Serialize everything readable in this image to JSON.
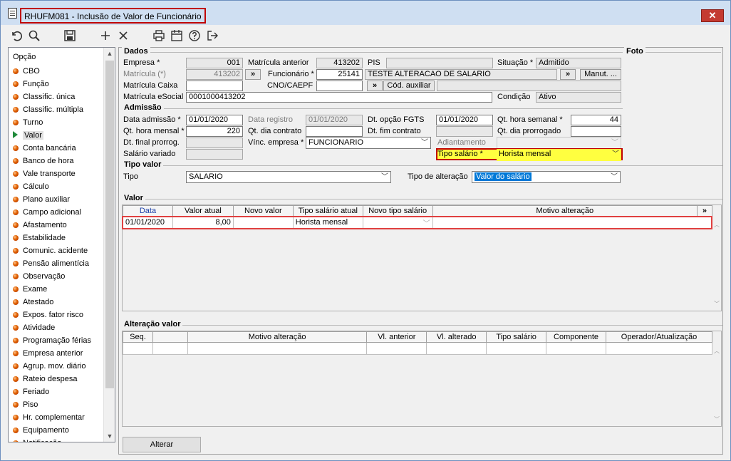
{
  "window": {
    "title": "RHUFM081 - Inclusão de Valor de Funcionário",
    "close_glyph": "✕"
  },
  "toolbar": {
    "icons": [
      "undo-icon",
      "search-icon",
      "save-icon",
      "add-icon",
      "delete-icon",
      "print-icon",
      "calendar-icon",
      "help-icon",
      "exit-icon"
    ]
  },
  "sidebar": {
    "header": "Opção",
    "items": [
      {
        "label": "CBO",
        "selected": false
      },
      {
        "label": "Função",
        "selected": false
      },
      {
        "label": "Classific. única",
        "selected": false
      },
      {
        "label": "Classific. múltipla",
        "selected": false
      },
      {
        "label": "Turno",
        "selected": false
      },
      {
        "label": "Valor",
        "selected": true
      },
      {
        "label": "Conta bancária",
        "selected": false
      },
      {
        "label": "Banco de hora",
        "selected": false
      },
      {
        "label": "Vale transporte",
        "selected": false
      },
      {
        "label": "Cálculo",
        "selected": false
      },
      {
        "label": "Plano auxiliar",
        "selected": false
      },
      {
        "label": "Campo adicional",
        "selected": false
      },
      {
        "label": "Afastamento",
        "selected": false
      },
      {
        "label": "Estabilidade",
        "selected": false
      },
      {
        "label": "Comunic. acidente",
        "selected": false
      },
      {
        "label": "Pensão alimentícia",
        "selected": false
      },
      {
        "label": "Observação",
        "selected": false
      },
      {
        "label": "Exame",
        "selected": false
      },
      {
        "label": "Atestado",
        "selected": false
      },
      {
        "label": "Expos. fator risco",
        "selected": false
      },
      {
        "label": "Atividade",
        "selected": false
      },
      {
        "label": "Programação férias",
        "selected": false
      },
      {
        "label": "Empresa anterior",
        "selected": false
      },
      {
        "label": "Agrup. mov. diário",
        "selected": false
      },
      {
        "label": "Rateio despesa",
        "selected": false
      },
      {
        "label": "Feriado",
        "selected": false
      },
      {
        "label": "Piso",
        "selected": false
      },
      {
        "label": "Hr. complementar",
        "selected": false
      },
      {
        "label": "Equipamento",
        "selected": false
      },
      {
        "label": "Notificação",
        "selected": false
      }
    ]
  },
  "dados": {
    "title": "Dados",
    "foto_title": "Foto",
    "empresa_label": "Empresa *",
    "empresa": "001",
    "matricula_anterior_label": "Matrícula anterior",
    "matricula_anterior": "413202",
    "pis_label": "PIS",
    "pis": "",
    "situacao_label": "Situação *",
    "situacao": "Admitido",
    "matricula_label": "Matrícula (*)",
    "matricula": "413202",
    "expand_btn": "»",
    "funcionario_label": "Funcionário *",
    "funcionario": "25141",
    "funcionario_nome": "TESTE ALTERACAO DE SALARIO",
    "manut_btn": "Manut. ...",
    "matricula_caixa_label": "Matrícula Caixa",
    "matricula_caixa": "",
    "cno_label": "CNO/CAEPF",
    "cno": "",
    "cod_auxiliar_btn": "Cód. auxiliar",
    "cod_auxiliar": "",
    "matricula_esocial_label": "Matrícula eSocial",
    "matricula_esocial": "0001000413202",
    "condicao_label": "Condição",
    "condicao": "Ativo"
  },
  "admissao": {
    "title": "Admissão",
    "data_admissao_label": "Data admissão *",
    "data_admissao": "01/01/2020",
    "data_registro_label": "Data registro",
    "data_registro": "01/01/2020",
    "dt_opcao_fgts_label": "Dt. opção FGTS",
    "dt_opcao_fgts": "01/01/2020",
    "qt_hora_semanal_label": "Qt. hora semanal *",
    "qt_hora_semanal": "44",
    "qt_hora_mensal_label": "Qt. hora mensal *",
    "qt_hora_mensal": "220",
    "qt_dia_contrato_label": "Qt. dia contrato",
    "qt_dia_contrato": "",
    "dt_fim_contrato_label": "Dt. fim contrato",
    "dt_fim_contrato": "",
    "qt_dia_prorrogado_label": "Qt. dia prorrogado",
    "qt_dia_prorrogado": "",
    "dt_final_prorrog_label": "Dt. final prorrog.",
    "dt_final_prorrog": "",
    "vinc_empresa_label": "Vínc. empresa *",
    "vinc_empresa": "FUNCIONARIO",
    "adiantamento_label": "Adiantamento",
    "adiantamento": "",
    "salario_variado_label": "Salário variado",
    "salario_variado": "",
    "tipo_salario_label": "Tipo salário *",
    "tipo_salario": "Horista mensal"
  },
  "tipo_valor": {
    "title": "Tipo valor",
    "tipo_label": "Tipo",
    "tipo": "SALARIO",
    "tipo_alteracao_label": "Tipo de alteração",
    "tipo_alteracao": "Valor do salário"
  },
  "valor": {
    "title": "Valor",
    "columns": [
      "Data",
      "Valor atual",
      "Novo valor",
      "Tipo salário atual",
      "Novo tipo salário",
      "Motivo alteração"
    ],
    "expand_btn": "»",
    "rows": [
      {
        "data": "01/01/2020",
        "valor_atual": "8,00",
        "novo_valor": "",
        "tipo_salario_atual": "Horista mensal",
        "novo_tipo_salario": "",
        "motivo": ""
      }
    ]
  },
  "alteracao_valor": {
    "title": "Alteração valor",
    "columns": [
      "Seq.",
      "Motivo alteração",
      "Vl. anterior",
      "Vl. alterado",
      "Tipo salário",
      "Componente",
      "Operador/Atualização"
    ]
  },
  "footer": {
    "alterar_btn": "Alterar"
  },
  "colors": {
    "highlight_yellow": "#ffff40",
    "highlight_border": "#c00000",
    "selection_blue": "#0078d7"
  }
}
